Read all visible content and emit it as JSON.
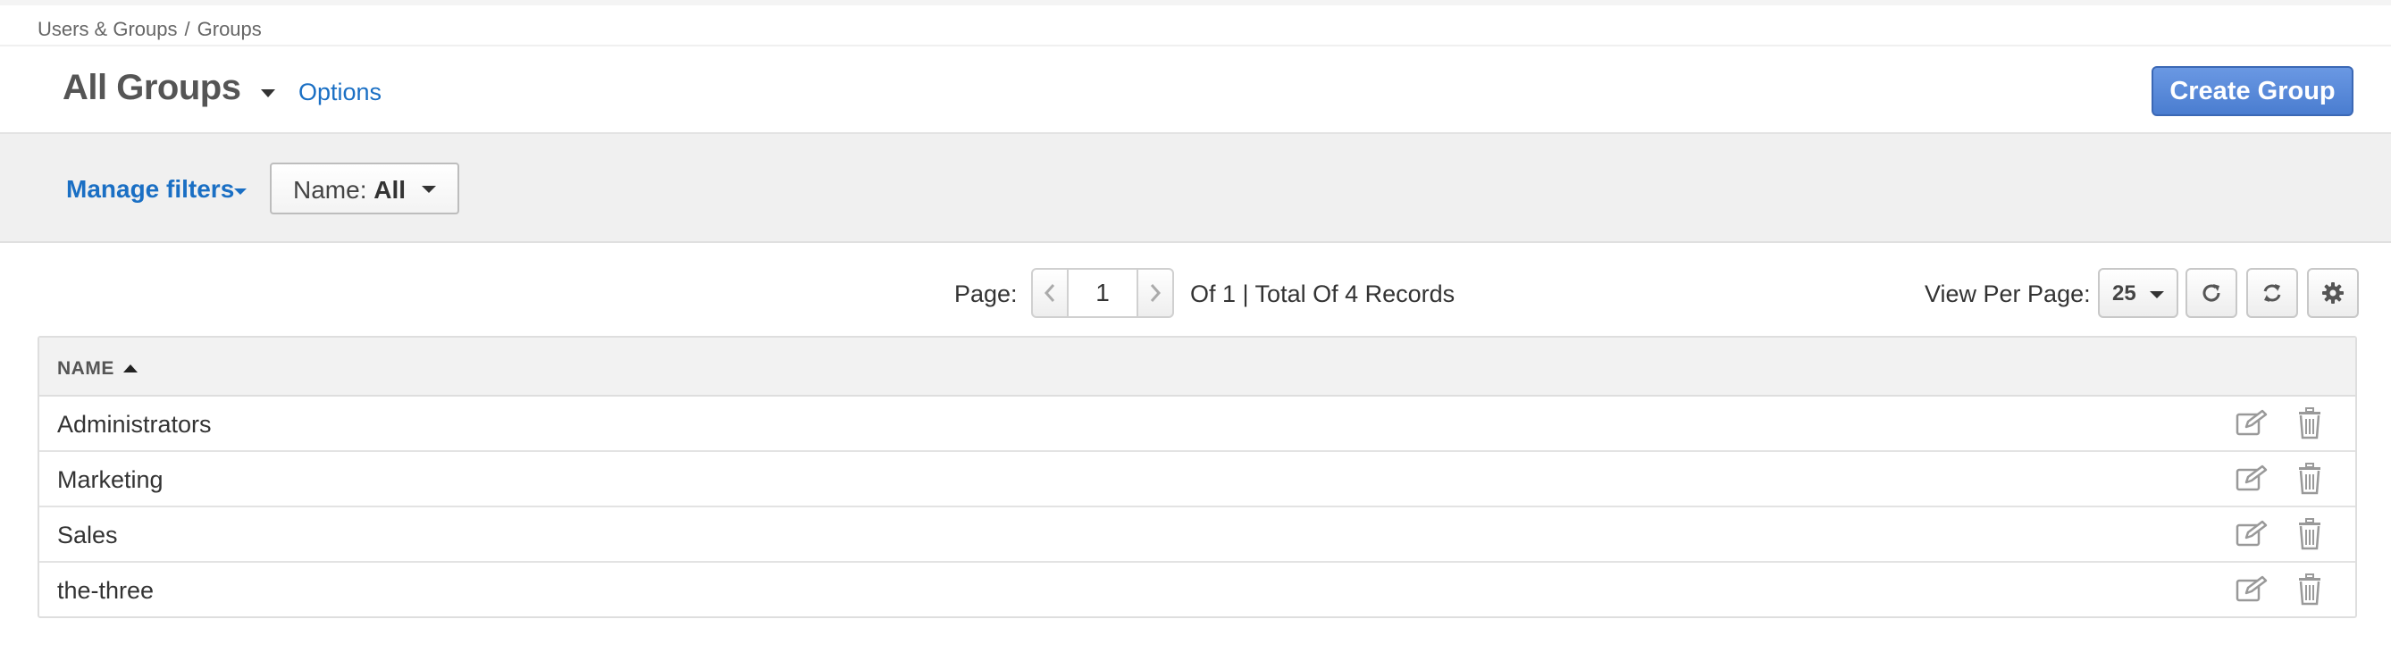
{
  "breadcrumb": {
    "parent": "Users & Groups",
    "separator": "/",
    "current": "Groups"
  },
  "header": {
    "title": "All Groups",
    "options_label": "Options",
    "create_label": "Create Group"
  },
  "filters": {
    "manage_label": "Manage filters",
    "name_label": "Name:",
    "name_value": "All"
  },
  "pager": {
    "label": "Page:",
    "current": "1",
    "info": "Of 1 | Total Of 4 Records"
  },
  "view_per_page": {
    "label": "View Per Page:",
    "value": "25"
  },
  "table": {
    "column": "NAME",
    "rows": [
      "Administrators",
      "Marketing",
      "Sales",
      "the-three"
    ]
  },
  "colors": {
    "accent": "#1a6fc4",
    "button": "#4a7dd0",
    "filter_bg": "#f0f0f0"
  },
  "icons": [
    "chevron-left-icon",
    "chevron-right-icon",
    "refresh-icon",
    "sync-icon",
    "gear-icon",
    "edit-icon",
    "trash-icon",
    "sort-ascending-icon"
  ]
}
